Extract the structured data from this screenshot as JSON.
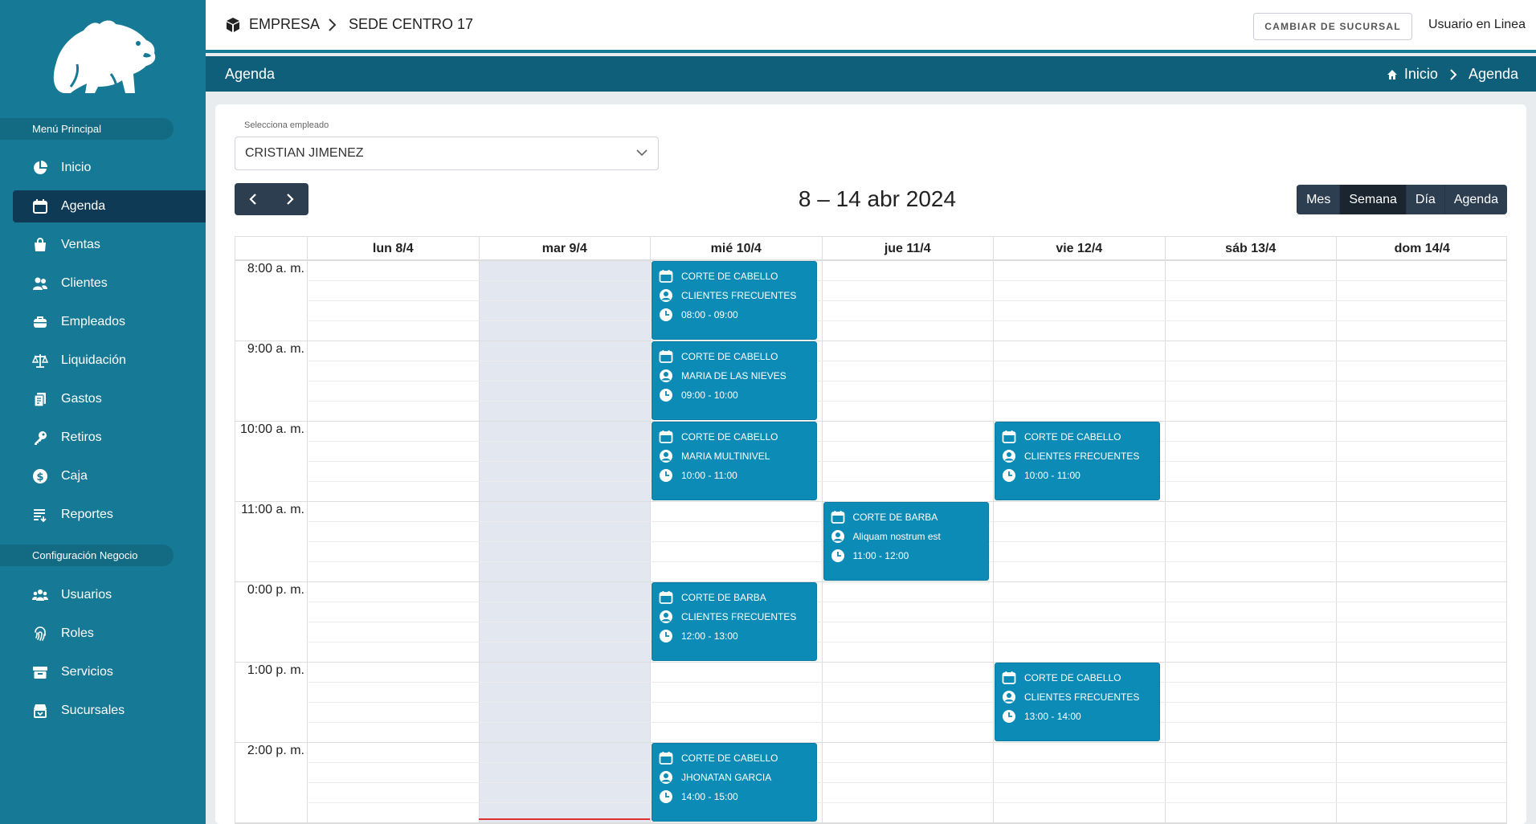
{
  "sidebar": {
    "section_main": "Menú Principal",
    "section_config": "Configuración Negocio",
    "items": [
      {
        "label": "Inicio",
        "icon": "pie-chart-icon"
      },
      {
        "label": "Agenda",
        "icon": "calendar-icon",
        "active": true
      },
      {
        "label": "Ventas",
        "icon": "shopping-bag-icon"
      },
      {
        "label": "Clientes",
        "icon": "users-icon"
      },
      {
        "label": "Empleados",
        "icon": "briefcase-icon"
      },
      {
        "label": "Liquidación",
        "icon": "scale-icon"
      },
      {
        "label": "Gastos",
        "icon": "receipt-icon"
      },
      {
        "label": "Retiros",
        "icon": "key-icon"
      },
      {
        "label": "Caja",
        "icon": "dollar-icon"
      },
      {
        "label": "Reportes",
        "icon": "list-icon"
      }
    ],
    "config_items": [
      {
        "label": "Usuarios",
        "icon": "users-cog-icon"
      },
      {
        "label": "Roles",
        "icon": "fingerprint-icon"
      },
      {
        "label": "Servicios",
        "icon": "box-icon"
      },
      {
        "label": "Sucursales",
        "icon": "store-icon"
      }
    ]
  },
  "topbar": {
    "company": "EMPRESA",
    "branch": "SEDE CENTRO 17",
    "change_branch": "CAMBIAR DE SUCURSAL",
    "user_status": "Usuario en Linea"
  },
  "titlebar": {
    "title": "Agenda",
    "crumb_home": "Inicio",
    "crumb_current": "Agenda"
  },
  "filter": {
    "label": "Selecciona empleado",
    "value": "CRISTIAN JIMENEZ"
  },
  "calendar": {
    "range": "8 – 14 abr 2024",
    "views": [
      "Mes",
      "Semana",
      "Día",
      "Agenda"
    ],
    "active_view": "Semana",
    "days": [
      "lun 8/4",
      "mar 9/4",
      "mié 10/4",
      "jue 11/4",
      "vie 12/4",
      "sáb 13/4",
      "dom 14/4"
    ],
    "today_index": 1,
    "hours": [
      "8:00 a. m.",
      "9:00 a. m.",
      "10:00 a. m.",
      "11:00 a. m.",
      "0:00 p. m.",
      "1:00 p. m.",
      "2:00 p. m."
    ],
    "events": [
      {
        "day": 2,
        "hour": 0,
        "service": "CORTE DE CABELLO",
        "client": "CLIENTES FRECUENTES",
        "time": "08:00 - 09:00"
      },
      {
        "day": 2,
        "hour": 1,
        "service": "CORTE DE CABELLO",
        "client": "MARIA DE LAS NIEVES",
        "time": "09:00 - 10:00"
      },
      {
        "day": 2,
        "hour": 2,
        "service": "CORTE DE CABELLO",
        "client": "MARIA MULTINIVEL",
        "time": "10:00 - 11:00"
      },
      {
        "day": 4,
        "hour": 2,
        "service": "CORTE DE CABELLO",
        "client": "CLIENTES FRECUENTES",
        "time": "10:00 - 11:00"
      },
      {
        "day": 3,
        "hour": 3,
        "service": "CORTE DE BARBA",
        "client": "Aliquam nostrum est",
        "time": "11:00 - 12:00"
      },
      {
        "day": 2,
        "hour": 4,
        "service": "CORTE DE BARBA",
        "client": "CLIENTES FRECUENTES",
        "time": "12:00 - 13:00"
      },
      {
        "day": 4,
        "hour": 5,
        "service": "CORTE DE CABELLO",
        "client": "CLIENTES FRECUENTES",
        "time": "13:00 - 14:00"
      },
      {
        "day": 2,
        "hour": 6,
        "service": "CORTE DE CABELLO",
        "client": "JHONATAN GARCIA",
        "time": "14:00 - 15:00"
      }
    ]
  },
  "colors": {
    "sidebar": "#167a96",
    "titlebar": "#0f5e7a",
    "event": "#0b8bb5",
    "nav_dark": "#2c3e50",
    "today_column": "#e3e8f0",
    "now_indicator": "#e03131"
  }
}
